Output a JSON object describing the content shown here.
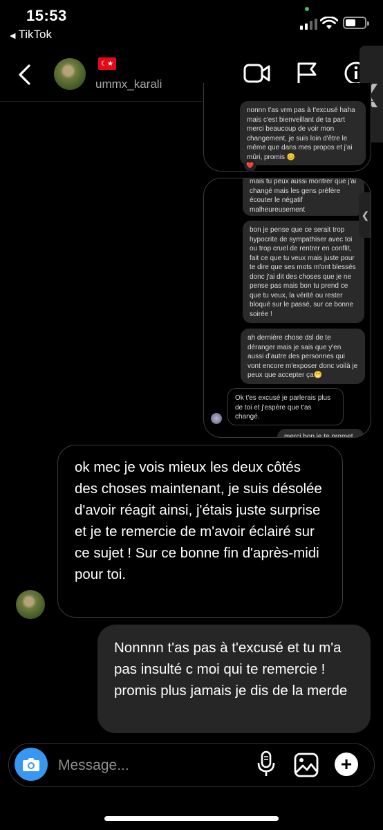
{
  "status_bar": {
    "time": "15:53",
    "back_app": "TikTok"
  },
  "header": {
    "flag": "🇹🇷",
    "username": "ummx_karali"
  },
  "embedded": {
    "panel1_messages": [
      "nonnn t'as vrm pas à t'excusé haha mais c'est bienveillant de ta part merci beaucoup de voir mon changement, je suis loin d'être le même que dans mes propos et j'ai mûri, promis 😊"
    ],
    "panel1_reaction": "❤️",
    "panel2_messages": [
      "mais tu peux aussi montrer que j'ai changé mais les gens préfère écouter le négatif malheureusement",
      "bon je pense que ce serait trop hypocrite de sympathiser avec toi ou trop cruel de rentrer en conflit, fait ce que tu veux mais juste pour te dire que ses mots m'ont blessés donc j'ai dit des choses que je ne pense pas mais bon tu prend ce que tu veux, la vérité ou rester bloqué sur le passé, sur ce bonne soirée !",
      "ah dernière chose dsl de te déranger mais je sais que y'en aussi d'autre des personnes qui vont encore m'exposer donc voilà je peux que accepter ça😁"
    ],
    "panel2_reply": "Ok t'es excusé je parlerais plus de toi et j'espère que t'as changé.",
    "panel2_cut": "merci bon je te promet"
  },
  "messages": {
    "incoming": "ok mec je vois mieux les deux côtés des choses maintenant, je suis désolée d'avoir réagit ainsi, j'étais juste surprise et je te remercie de m'avoir éclairé sur ce sujet ! Sur ce bonne fin d'après-midi pour toi.",
    "outgoing": "Nonnnn t'as pas à t'excusé et tu m'a pas insulté c moi qui te remercie ! promis plus jamais je dis de la merde"
  },
  "composer": {
    "placeholder": "Message..."
  },
  "colors": {
    "background": "#000000",
    "bubble_out": "#262626",
    "camera": "#3897f0",
    "flag": "#e30a17"
  }
}
